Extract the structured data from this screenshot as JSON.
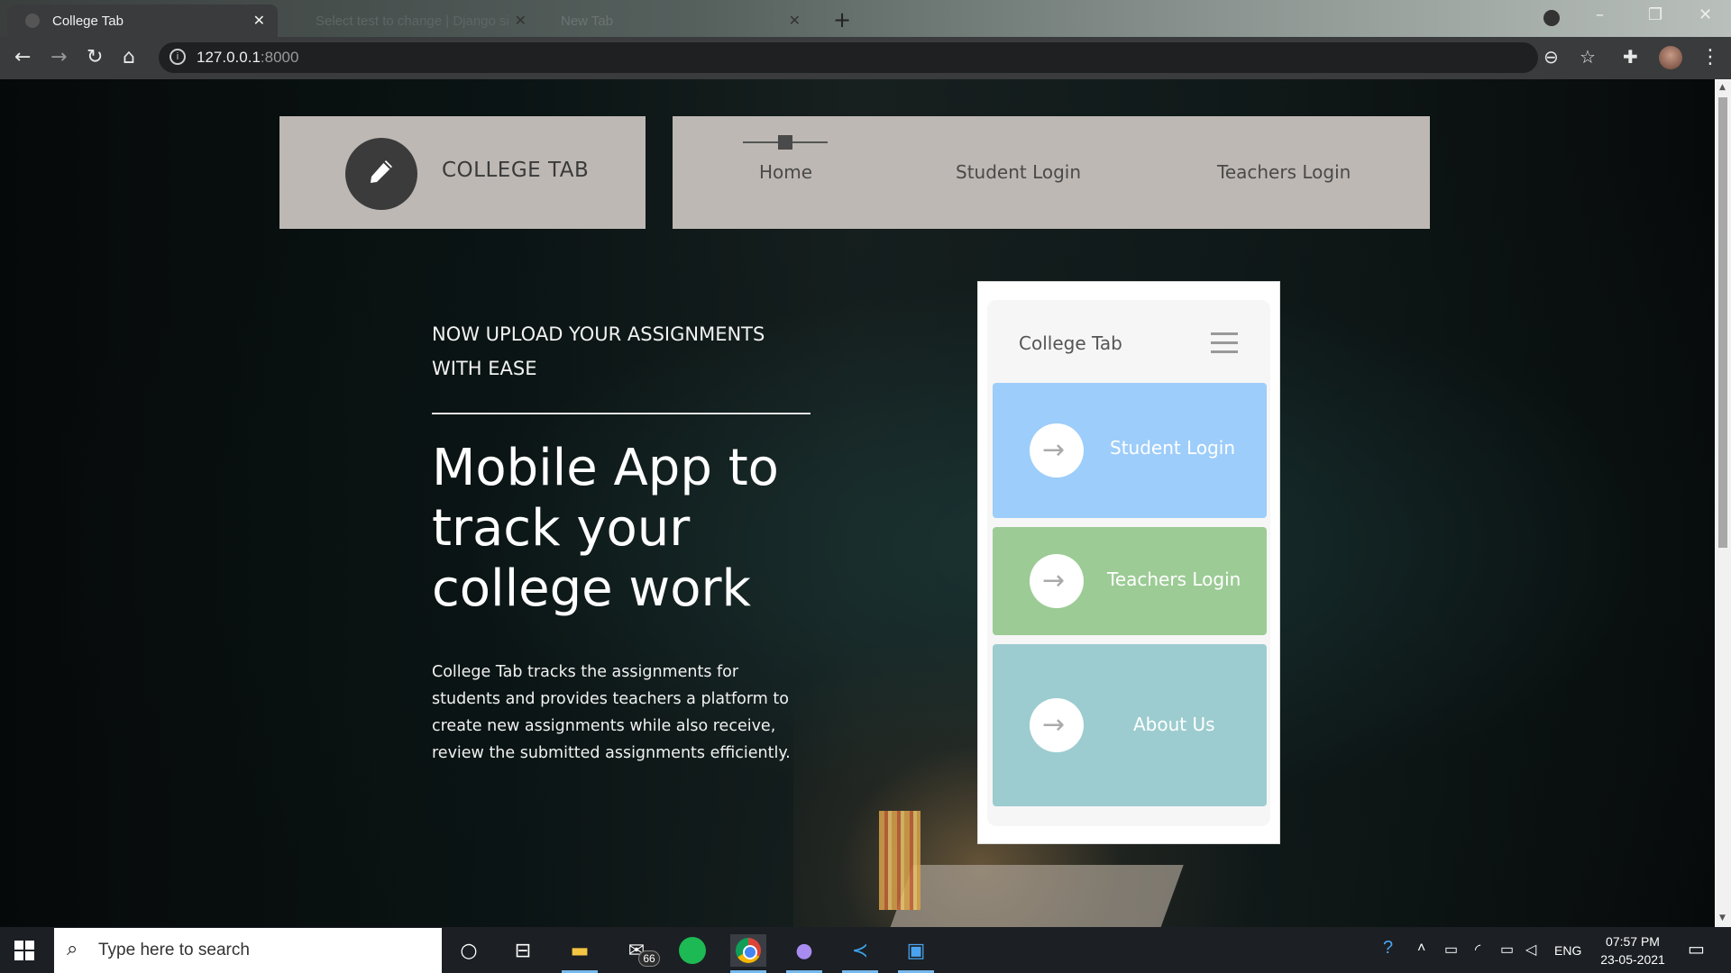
{
  "browser": {
    "tabs": [
      {
        "title": "College Tab",
        "active": true
      },
      {
        "title": "Select test to change | Django si",
        "active": false
      },
      {
        "title": "New Tab",
        "active": false
      }
    ],
    "new_tab_icon": "plus-icon",
    "url_host": "127.0.0.1",
    "url_port": ":8000",
    "toolbar_icons": [
      "back-icon",
      "forward-icon",
      "reload-icon",
      "home-icon",
      "info-icon",
      "zoom-icon",
      "star-icon",
      "extensions-icon",
      "menu-icon"
    ]
  },
  "site": {
    "brand": {
      "title": "COLLEGE TAB",
      "icon": "pencil-icon"
    },
    "nav": [
      {
        "label": "Home"
      },
      {
        "label": "Student Login"
      },
      {
        "label": "Teachers Login"
      }
    ],
    "hero": {
      "kicker": "NOW UPLOAD YOUR ASSIGNMENTS WITH EASE",
      "title": "Mobile App to track your college work",
      "body": "College Tab tracks the assignments for students and provides teachers a platform to create new assignments while also receive, review the submitted assignments efficiently."
    },
    "phone": {
      "title": "College Tab",
      "menu_icon": "hamburger-icon",
      "cards": [
        {
          "label": "Student Login",
          "color": "#9dcdfa",
          "icon": "arrow-right-icon"
        },
        {
          "label": "Teachers Login",
          "color": "#9ccb95",
          "icon": "arrow-right-icon"
        },
        {
          "label": "About Us",
          "color": "#9ccccf",
          "icon": "arrow-right-icon"
        }
      ]
    }
  },
  "taskbar": {
    "search_placeholder": "Type here to search",
    "mail_badge": "66",
    "language": "ENG",
    "time": "07:57 PM",
    "date": "23-05-2021",
    "apps": [
      "cortana-icon",
      "task-view-icon",
      "file-explorer-icon",
      "mail-icon",
      "spotify-icon",
      "chrome-icon",
      "github-icon",
      "vscode-icon",
      "photos-icon"
    ]
  }
}
